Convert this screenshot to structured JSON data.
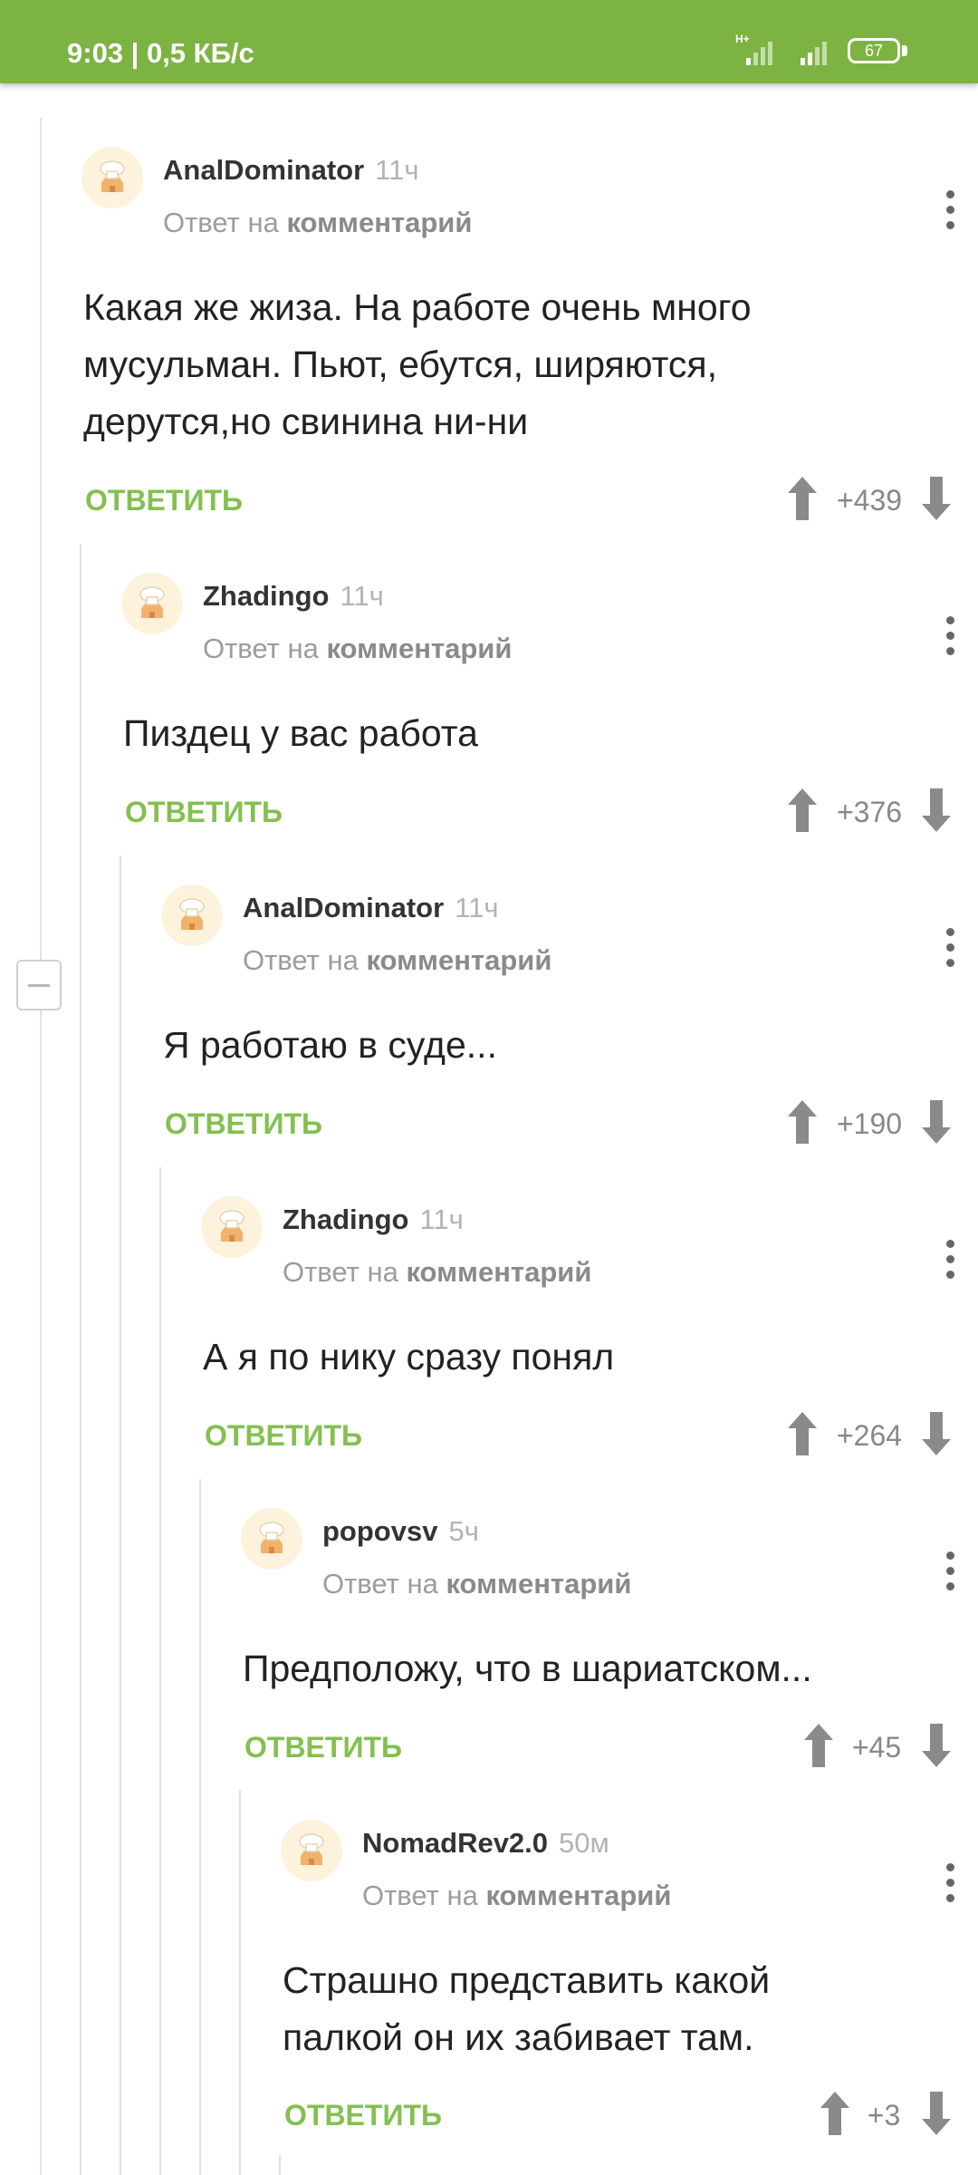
{
  "status_bar": {
    "time_speed": "9:03 | 0,5 КБ/с",
    "network_type": "H+",
    "battery": "67",
    "bg_color": "#7cb342"
  },
  "reply_label": "ОТВЕТИТЬ",
  "reply_to_prefix": "Ответ на",
  "reply_to_link": "комментарий",
  "comments": [
    {
      "user": "AnalDominator",
      "time": "11ч",
      "text": "Какая же жиза. На работе очень много мусульман. Пьют, ебутся, ширяются, дерутся,но свинина ни-ни",
      "score": "+439"
    },
    {
      "user": "Zhadingo",
      "time": "11ч",
      "text": "Пиздец у вас работа",
      "score": "+376"
    },
    {
      "user": "AnalDominator",
      "time": "11ч",
      "text": "Я работаю в суде...",
      "score": "+190"
    },
    {
      "user": "Zhadingo",
      "time": "11ч",
      "text": "А я по нику сразу понял",
      "score": "+264"
    },
    {
      "user": "popovsv",
      "time": "5ч",
      "text": "Предположу, что в шариатском...",
      "score": "+45"
    },
    {
      "user": "NomadRev2.0",
      "time": "50м",
      "text": "Страшно представить какой палкой он их забивает там.",
      "score": "+3"
    }
  ],
  "icons": {
    "avatar": "chef-hat-avatar-icon",
    "menu": "more-vertical-icon",
    "upvote": "arrow-up-icon",
    "downvote": "arrow-down-icon",
    "collapse": "collapse-thread-icon",
    "signal": "signal-icon"
  },
  "colors": {
    "accent": "#84c050",
    "thread_line": "#e1e1e1",
    "vote_arrow": "#8a8a8a"
  }
}
